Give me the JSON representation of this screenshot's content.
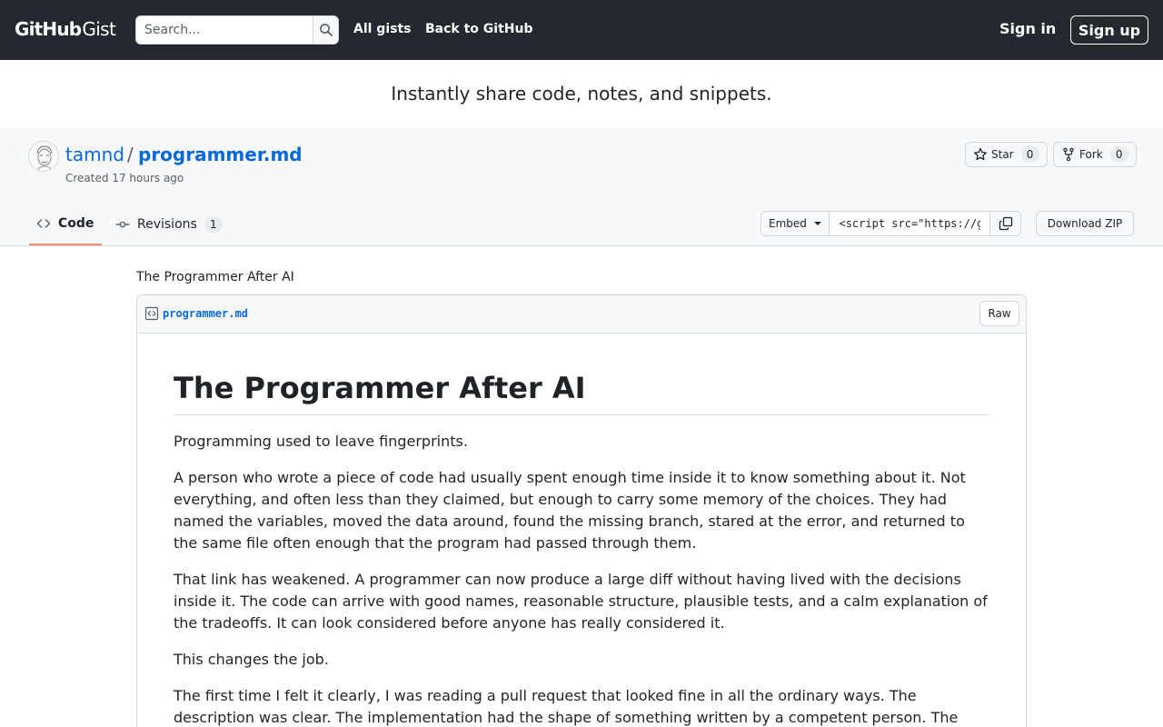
{
  "header": {
    "logo_primary": "GitHub",
    "logo_secondary": "Gist",
    "search_placeholder": "Search...",
    "nav": [
      "All gists",
      "Back to GitHub"
    ],
    "sign_in": "Sign in",
    "sign_up": "Sign up",
    "background_color": "#24292f"
  },
  "tagline": "Instantly share code, notes, and snippets.",
  "gist": {
    "owner": "tamnd",
    "separator": "/",
    "name": "programmer.md",
    "created": "Created 17 hours ago",
    "star_label": "Star",
    "star_count": "0",
    "fork_label": "Fork",
    "fork_count": "0"
  },
  "tabs": [
    {
      "label": "Code",
      "active": true
    },
    {
      "label": "Revisions",
      "count": "1",
      "active": false
    }
  ],
  "embed": {
    "label": "Embed",
    "value": "<script src=\"https://gist.github.com/tamnd/",
    "download_label": "Download ZIP"
  },
  "description": "The Programmer After AI",
  "file": {
    "name": "programmer.md",
    "raw_label": "Raw"
  },
  "article": {
    "title": "The Programmer After AI",
    "paragraphs": [
      "Programming used to leave fingerprints.",
      "A person who wrote a piece of code had usually spent enough time inside it to know something about it. Not everything, and often less than they claimed, but enough to carry some memory of the choices. They had named the variables, moved the data around, found the missing branch, stared at the error, and returned to the same file often enough that the program had passed through them.",
      "That link has weakened. A programmer can now produce a large diff without having lived with the decisions inside it. The code can arrive with good names, reasonable structure, plausible tests, and a calm explanation of the tradeoffs. It can look considered before anyone has really considered it.",
      "This changes the job.",
      "The first time I felt it clearly, I was reading a pull request that looked fine in all the ordinary ways. The description was clear. The implementation had the shape of something written by a competent person. The"
    ]
  },
  "icons": {
    "search": "search-icon",
    "star": "star-icon",
    "fork": "repo-forked-icon",
    "code": "code-icon",
    "revisions": "git-commit-icon",
    "copy": "copy-icon",
    "file": "file-code-icon"
  }
}
